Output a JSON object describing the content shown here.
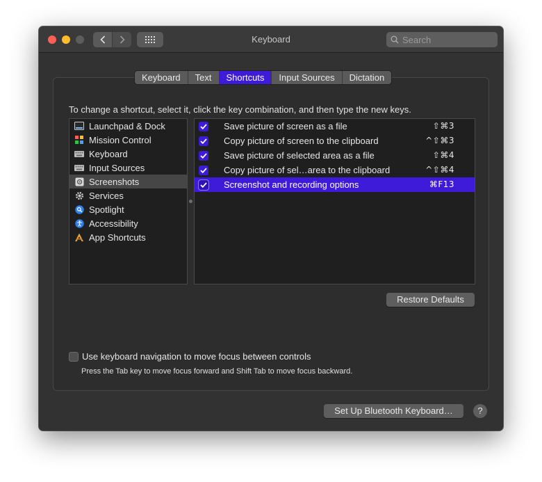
{
  "window": {
    "title": "Keyboard"
  },
  "search": {
    "placeholder": "Search"
  },
  "tabs": [
    {
      "label": "Keyboard",
      "active": false
    },
    {
      "label": "Text",
      "active": false
    },
    {
      "label": "Shortcuts",
      "active": true
    },
    {
      "label": "Input Sources",
      "active": false
    },
    {
      "label": "Dictation",
      "active": false
    }
  ],
  "instruction": "To change a shortcut, select it, click the key combination, and then type the new keys.",
  "categories": [
    {
      "label": "Launchpad & Dock",
      "icon": "launchpad-dock-icon",
      "selected": false
    },
    {
      "label": "Mission Control",
      "icon": "mission-control-icon",
      "selected": false
    },
    {
      "label": "Keyboard",
      "icon": "keyboard-icon",
      "selected": false
    },
    {
      "label": "Input Sources",
      "icon": "input-sources-icon",
      "selected": false
    },
    {
      "label": "Screenshots",
      "icon": "screenshots-icon",
      "selected": true
    },
    {
      "label": "Services",
      "icon": "gear-icon",
      "selected": false
    },
    {
      "label": "Spotlight",
      "icon": "spotlight-icon",
      "selected": false
    },
    {
      "label": "Accessibility",
      "icon": "accessibility-icon",
      "selected": false
    },
    {
      "label": "App Shortcuts",
      "icon": "app-shortcuts-icon",
      "selected": false
    }
  ],
  "shortcuts": [
    {
      "label": "Save picture of screen as a file",
      "keys": "⇧⌘3",
      "checked": true,
      "selected": false
    },
    {
      "label": "Copy picture of screen to the clipboard",
      "keys": "^⇧⌘3",
      "checked": true,
      "selected": false
    },
    {
      "label": "Save picture of selected area as a file",
      "keys": "⇧⌘4",
      "checked": true,
      "selected": false
    },
    {
      "label": "Copy picture of sel…area to the clipboard",
      "keys": "^⇧⌘4",
      "checked": true,
      "selected": false
    },
    {
      "label": "Screenshot and recording options",
      "keys": "⌘F13",
      "checked": true,
      "selected": true
    }
  ],
  "buttons": {
    "restore_defaults": "Restore Defaults",
    "bluetooth": "Set Up Bluetooth Keyboard…",
    "help": "?"
  },
  "keyboard_navigation": {
    "label": "Use keyboard navigation to move focus between controls",
    "hint": "Press the Tab key to move focus forward and Shift Tab to move focus backward.",
    "checked": false
  },
  "colors": {
    "accent": "#3d1bd8",
    "close": "#ff5f57",
    "minimize": "#febc2e"
  }
}
